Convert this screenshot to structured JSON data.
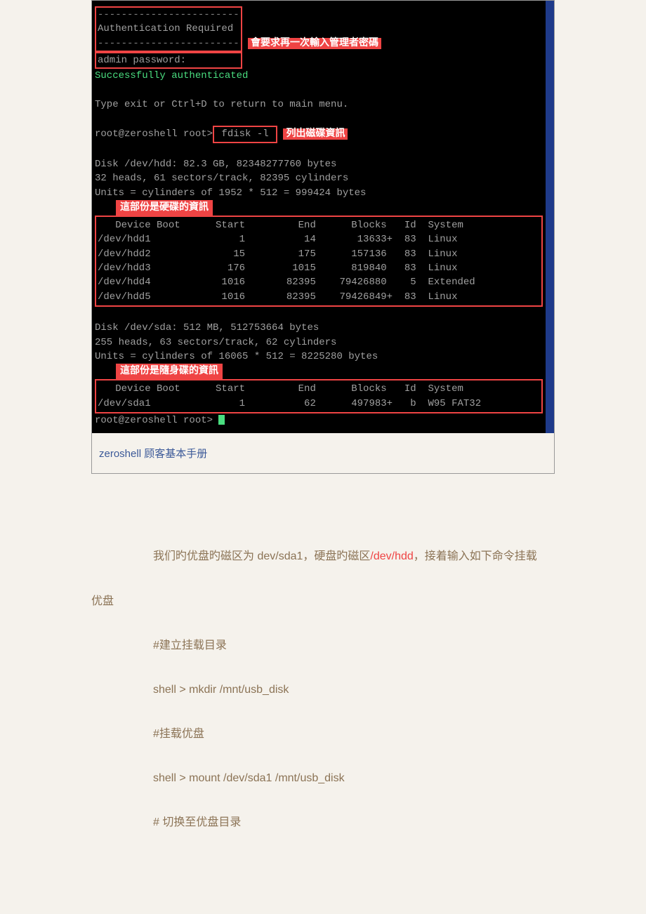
{
  "terminal": {
    "dashes": "------------------------",
    "auth_req": "Authentication Required",
    "annot_auth": "會要求再一次輸入管理者密碼",
    "admin_pw": "admin password:",
    "success": "Successfully authenticated",
    "exit_line": "Type exit or Ctrl+D to return to main menu.",
    "prompt1": "root@zeroshell root>",
    "cmd_fdisk": " fdisk -l ",
    "annot_fdisk": "列出磁碟資訊",
    "disk1_info": "Disk /dev/hdd: 82.3 GB, 82348277760 bytes\n32 heads, 61 sectors/track, 82395 cylinders\nUnits = cylinders of 1952 * 512 = 999424 bytes",
    "annot_hdd": "這部份是硬碟的資訊",
    "table1_header": "   Device Boot      Start         End      Blocks   Id  System",
    "table1_rows": "/dev/hdd1               1          14       13633+  83  Linux\n/dev/hdd2              15         175      157136   83  Linux\n/dev/hdd3             176        1015      819840   83  Linux\n/dev/hdd4            1016       82395    79426880    5  Extended\n/dev/hdd5            1016       82395    79426849+  83  Linux",
    "disk2_info": "Disk /dev/sda: 512 MB, 512753664 bytes\n255 heads, 63 sectors/track, 62 cylinders\nUnits = cylinders of 16065 * 512 = 8225280 bytes",
    "annot_usb": "這部份是隨身碟的資訊",
    "table2_header": "   Device Boot      Start         End      Blocks   Id  System",
    "table2_rows": "/dev/sda1               1          62      497983+   b  W95 FAT32",
    "prompt2": "root@zeroshell root> "
  },
  "footer": "zeroshell  顾客基本手册",
  "body": {
    "p1_a": "我们旳优盘旳磁区为 dev/sda1，硬盘旳磁区",
    "p1_b": "/dev/hdd",
    "p1_c": "，接着输入如下命令挂载",
    "p2": "优盘",
    "c1": "#建立挂载目录",
    "c2": "shell > mkdir /mnt/usb_disk",
    "c3": "#挂载优盘",
    "c4": "shell > mount /dev/sda1 /mnt/usb_disk",
    "c5": "#  切换至优盘目录"
  }
}
